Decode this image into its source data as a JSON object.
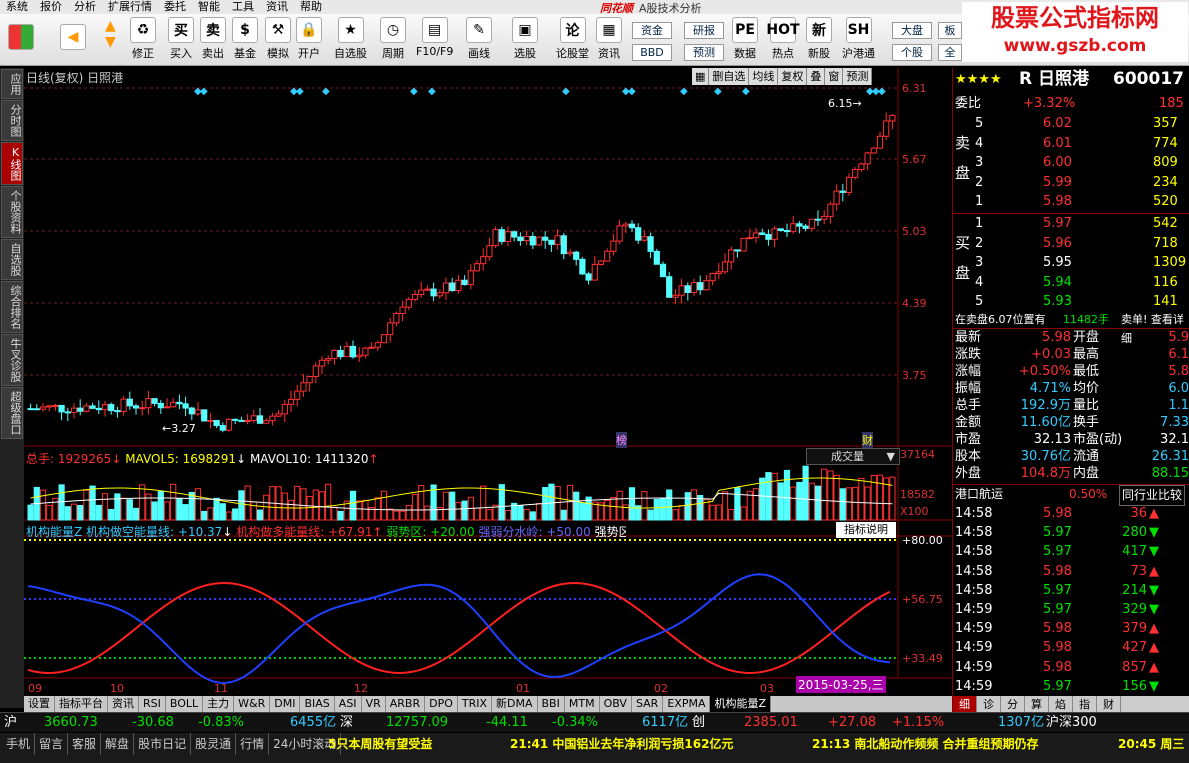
{
  "menu": [
    "系统",
    "报价",
    "分析",
    "扩展行情",
    "委托",
    "智能",
    "工具",
    "资讯",
    "帮助"
  ],
  "app": {
    "brand": "同花顺",
    "title": "A股技术分析"
  },
  "toolbar": [
    {
      "label": "修正",
      "icon": "♻"
    },
    {
      "label": "买入",
      "icon": "买"
    },
    {
      "label": "卖出",
      "icon": "卖"
    },
    {
      "label": "基金",
      "icon": "$"
    },
    {
      "label": "模拟",
      "icon": "⚒"
    },
    {
      "label": "开户",
      "icon": "🔒"
    },
    {
      "label": "自选股",
      "icon": "★"
    },
    {
      "label": "周期",
      "icon": "◷"
    },
    {
      "label": "F10/F9",
      "icon": "▤"
    },
    {
      "label": "画线",
      "icon": "✎"
    },
    {
      "label": "选股",
      "icon": "▣"
    },
    {
      "label": "论股堂",
      "icon": "论"
    },
    {
      "label": "资讯",
      "icon": "▦"
    },
    {
      "label": "数据",
      "icon": "PE"
    },
    {
      "label": "热点",
      "icon": "HOT"
    },
    {
      "label": "新股",
      "icon": "新"
    },
    {
      "label": "沪港通",
      "icon": "SH"
    }
  ],
  "toolbar_small": [
    "资金",
    "BBD",
    "研报",
    "预测",
    "大盘",
    "个股",
    "板",
    "全"
  ],
  "logo": {
    "line1": "股票公式指标网",
    "line2": "www.gszb.com"
  },
  "left_tabs": [
    "应用",
    "分时图",
    "K线图",
    "个股资料",
    "自选股",
    "综合排名",
    "牛叉诊股",
    "超级盘口"
  ],
  "chart": {
    "header": "日线(复权) 日照港",
    "tools": [
      "▦",
      "删自选",
      "均线",
      "复权",
      "叠",
      "窗",
      "预测"
    ],
    "price_labels": [
      "6.31",
      "5.67",
      "5.03",
      "4.39",
      "3.75"
    ],
    "high_note": "6.15",
    "low_note": "3.27",
    "marks": [
      "榜",
      "财"
    ],
    "vol_header": {
      "a": "总手: 1929265",
      "b": "MAVOL5: 1698291",
      "c": "MAVOL10: 1411320"
    },
    "vol_select": "成交量",
    "vol_labels": [
      "37164",
      "18582",
      "X100"
    ],
    "ind_header": {
      "a": "机构能量Z 机构做空能量线: +10.37",
      "b": "机构做多能量线: +67.91",
      "c": "弱势区: +20.00",
      "d": "强弱分水岭: +50.00",
      "e": "强势区: +80"
    },
    "ind_button": "指标说明",
    "ind_labels": [
      "+80.00",
      "+56.75",
      "+33.49"
    ],
    "months": [
      "09",
      "10",
      "11",
      "12",
      "01",
      "02",
      "03"
    ],
    "date_badge": "2015-03-25,三"
  },
  "bottom_tabs": [
    "设置",
    "指标平台",
    "资讯",
    "RSI",
    "BOLL",
    "主力",
    "W&R",
    "DMI",
    "BIAS",
    "ASI",
    "VR",
    "ARBR",
    "DPO",
    "TRIX",
    "新DMA",
    "BBI",
    "MTM",
    "OBV",
    "SAR",
    "EXPMA",
    "机构能量Z"
  ],
  "quote": {
    "stars": "★★★★",
    "name": "R 日照港",
    "code": "600017",
    "weibi_label": "委比",
    "weibi": "+3.32%",
    "weibi_r": "185",
    "sell_label": "卖盘",
    "buy_label": "买盘",
    "sell": [
      {
        "n": "5",
        "p": "6.02",
        "v": "357"
      },
      {
        "n": "4",
        "p": "6.01",
        "v": "774"
      },
      {
        "n": "3",
        "p": "6.00",
        "v": "809"
      },
      {
        "n": "2",
        "p": "5.99",
        "v": "234"
      },
      {
        "n": "1",
        "p": "5.98",
        "v": "520"
      }
    ],
    "buy": [
      {
        "n": "1",
        "p": "5.97",
        "v": "542"
      },
      {
        "n": "2",
        "p": "5.96",
        "v": "718"
      },
      {
        "n": "3",
        "p": "5.95",
        "v": "1309"
      },
      {
        "n": "4",
        "p": "5.94",
        "v": "116"
      },
      {
        "n": "5",
        "p": "5.93",
        "v": "141"
      }
    ],
    "notice": "在卖盘6.07位置有",
    "notice2": "11482手",
    "notice3": "卖单! 查看详细",
    "stats": [
      [
        "最新",
        "5.98",
        "开盘",
        "5.9"
      ],
      [
        "涨跌",
        "+0.03",
        "最高",
        "6.1"
      ],
      [
        "涨幅",
        "+0.50%",
        "最低",
        "5.8"
      ],
      [
        "振幅",
        "4.71%",
        "均价",
        "6.0"
      ],
      [
        "总手",
        "192.9万",
        "量比",
        "1.1"
      ],
      [
        "金额",
        "11.60亿",
        "换手",
        "7.33"
      ],
      [
        "市盈",
        "32.13",
        "市盈(动)",
        "32.1"
      ],
      [
        "股本",
        "30.76亿",
        "流通",
        "26.31"
      ],
      [
        "外盘",
        "104.8万",
        "内盘",
        "88.15"
      ]
    ],
    "industry": "港口航运",
    "industry_pct": "0.50%",
    "industry_btn": "同行业比较",
    "ticks": [
      [
        "14:58",
        "5.98",
        "36",
        "up"
      ],
      [
        "14:58",
        "5.97",
        "280",
        "dn"
      ],
      [
        "14:58",
        "5.97",
        "417",
        "dn"
      ],
      [
        "14:58",
        "5.98",
        "73",
        "up"
      ],
      [
        "14:58",
        "5.97",
        "214",
        "dn"
      ],
      [
        "14:59",
        "5.97",
        "329",
        "dn"
      ],
      [
        "14:59",
        "5.98",
        "379",
        "up"
      ],
      [
        "14:59",
        "5.98",
        "427",
        "up"
      ],
      [
        "14:59",
        "5.98",
        "857",
        "up"
      ],
      [
        "14:59",
        "5.97",
        "156",
        "dn"
      ]
    ],
    "tabs": [
      "细",
      "诊",
      "分",
      "算",
      "焰",
      "指",
      "财"
    ]
  },
  "status": {
    "sh": "沪",
    "sh_v": "3660.73",
    "sh_c": "-30.68",
    "sh_p": "-0.83%",
    "sh_a": "6455亿",
    "sz": "深",
    "sz_v": "12757.09",
    "sz_c": "-44.11",
    "sz_p": "-0.34%",
    "sz_a": "6117亿",
    "cy": "创",
    "cy_v": "2385.01",
    "cy_c": "+27.08",
    "cy_p": "+1.15%",
    "cy_a": "1307亿",
    "hs": "沪深300"
  },
  "bottom": {
    "items": [
      "手机",
      "留言",
      "客服",
      "解盘",
      "股市日记",
      "股灵通",
      "行情",
      "24小时滚动"
    ],
    "news1": "5只本周股有望受益",
    "news2": "21:41 中国铝业去年净利润亏损162亿元",
    "news3": "21:13 南北船动作频频 合并重组预期仍存",
    "news4": "20:45 周三"
  }
}
